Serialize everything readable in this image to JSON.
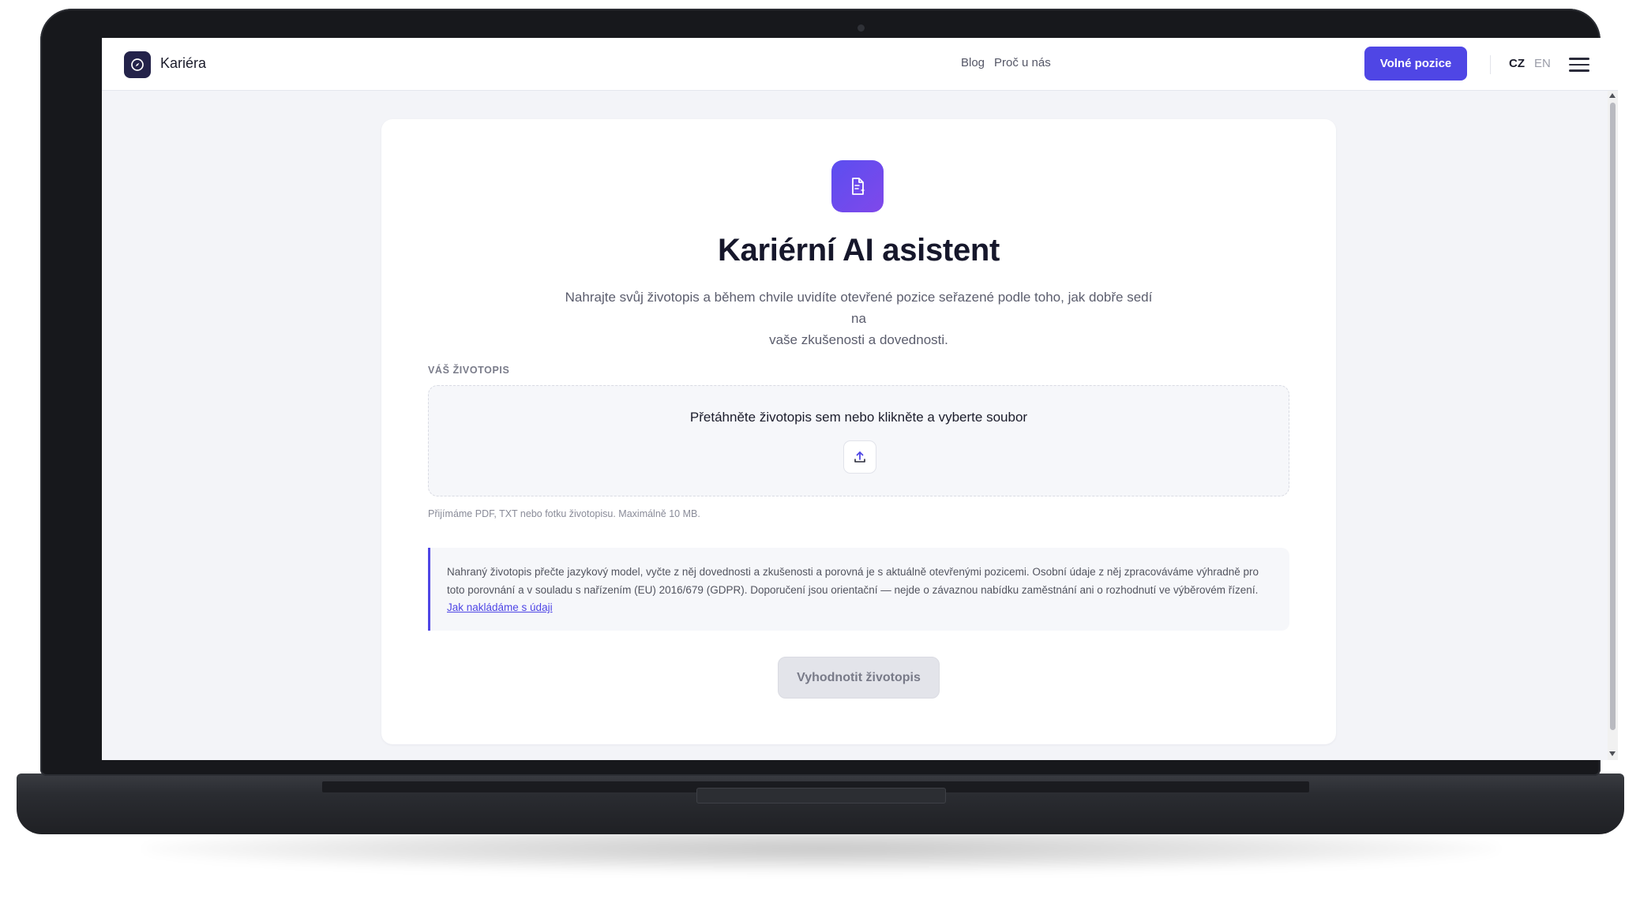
{
  "header": {
    "brand": "Kariéra",
    "nav": [
      {
        "label": "Blog"
      },
      {
        "label": "Proč u nás"
      }
    ],
    "cta_label": "Volné pozice",
    "languages": [
      {
        "code": "CZ",
        "active": true
      },
      {
        "code": "EN",
        "active": false
      }
    ]
  },
  "main": {
    "title": "Kariérní AI asistent",
    "subtitle_line1": "Nahrajte svůj životopis a během chvile uvidíte otevřené pozice seřazené podle toho, jak dobře sedí na",
    "subtitle_line2": "vaše zkušenosti a dovednosti.",
    "section_label": "VÁŠ ŽIVOTOPIS",
    "dropzone_text": "Přetáhněte životopis sem nebo klikněte a vyberte soubor",
    "hint": "Přijímáme PDF, TXT nebo fotku životopisu. Maximálně 10 MB.",
    "notice_text": "Nahraný životopis přečte jazykový model, vyčte z něj dovednosti a zkušenosti a porovná je s aktuálně otevřenými pozicemi. Osobní údaje z něj zpracováváme výhradně pro toto porovnání a v souladu s nařízením (EU) 2016/679 (GDPR). Doporučení jsou orientační — nejde o závaznou nabídku zaměstnání ani o rozhodnutí ve výběrovém řízení. ",
    "notice_link": "Jak nakládáme s údaji",
    "submit_label": "Vyhodnotit životopis"
  },
  "icons": {
    "logo": "compass-icon",
    "hero": "document-sparkle-icon",
    "upload": "upload-icon",
    "menu": "hamburger-menu-icon"
  },
  "colors": {
    "accent": "#4f46e5",
    "background": "#f3f4f8",
    "text_dark": "#16172b"
  }
}
